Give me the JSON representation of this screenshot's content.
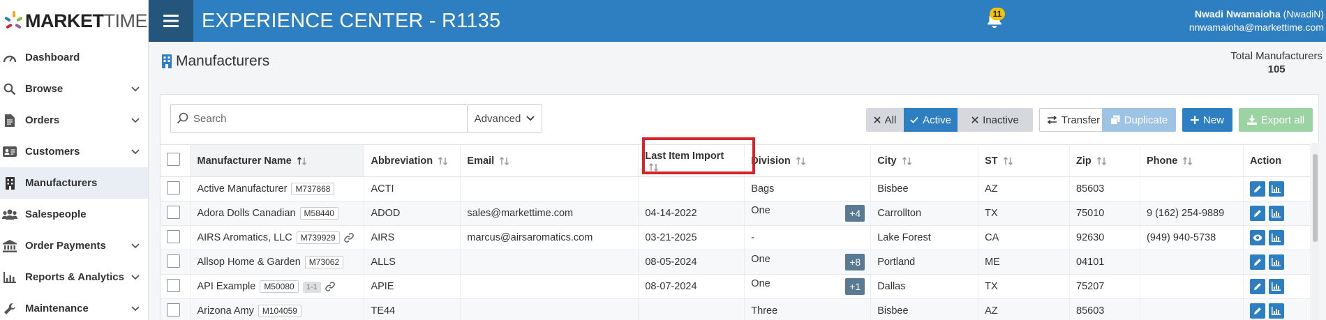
{
  "brand": {
    "logo_bold": "MARKET",
    "logo_thin": "TIME"
  },
  "header": {
    "title": "EXPERIENCE CENTER - R1135",
    "notification_count": "11",
    "user_name": "Nwadi Nwamaioha",
    "user_handle": "(NwadiN)",
    "user_email": "nnwamaioha@markettime.com"
  },
  "sidebar": {
    "items": [
      {
        "label": "Dashboard",
        "icon": "gauge-icon",
        "has_children": false
      },
      {
        "label": "Browse",
        "icon": "search-icon",
        "has_children": true
      },
      {
        "label": "Orders",
        "icon": "document-icon",
        "has_children": true
      },
      {
        "label": "Customers",
        "icon": "id-card-icon",
        "has_children": true
      },
      {
        "label": "Manufacturers",
        "icon": "building-icon",
        "has_children": false,
        "active": true
      },
      {
        "label": "Salespeople",
        "icon": "users-icon",
        "has_children": false
      },
      {
        "label": "Order Payments",
        "icon": "bank-icon",
        "has_children": true
      },
      {
        "label": "Reports & Analytics",
        "icon": "chart-icon",
        "has_children": true
      },
      {
        "label": "Maintenance",
        "icon": "wrench-icon",
        "has_children": true
      }
    ]
  },
  "page": {
    "title": "Manufacturers",
    "total_label": "Total Manufacturers",
    "total_value": "105"
  },
  "toolbar": {
    "search_placeholder": "Search",
    "advanced_label": "Advanced",
    "filter_all": "All",
    "filter_active": "Active",
    "filter_inactive": "Inactive",
    "transfer_label": "Transfer",
    "duplicate_label": "Duplicate",
    "new_label": "New",
    "export_label": "Export all"
  },
  "table": {
    "columns": {
      "name": "Manufacturer Name",
      "abbreviation": "Abbreviation",
      "email": "Email",
      "last_import": "Last Item Import",
      "division": "Division",
      "city": "City",
      "st": "ST",
      "zip": "Zip",
      "phone": "Phone",
      "action": "Action"
    },
    "rows": [
      {
        "name": "Active Manufacturer",
        "code": "M737868",
        "abbr": "ACTI",
        "email": "",
        "last_import": "",
        "division": "Bags",
        "division_extra": "",
        "city": "Bisbee",
        "st": "AZ",
        "zip": "85603",
        "phone": ""
      },
      {
        "name": "Adora Dolls Canadian",
        "code": "M58440",
        "abbr": "ADOD",
        "email": "sales@markettime.com",
        "last_import": "04-14-2022",
        "division": "One",
        "division_extra": "+4",
        "city": "Carrollton",
        "st": "TX",
        "zip": "75010",
        "phone": "9 (162) 254-9889"
      },
      {
        "name": "AIRS Aromatics, LLC",
        "code": "M739929",
        "abbr": "AIRS",
        "email": "marcus@airsaromatics.com",
        "last_import": "03-21-2025",
        "division": "-",
        "division_extra": "",
        "city": "Lake Forest",
        "st": "CA",
        "zip": "92630",
        "phone": "(949) 940-5738"
      },
      {
        "name": "Allsop Home & Garden",
        "code": "M73062",
        "abbr": "ALLS",
        "email": "",
        "last_import": "08-05-2024",
        "division": "One",
        "division_extra": "+8",
        "city": "Portland",
        "st": "ME",
        "zip": "04101",
        "phone": ""
      },
      {
        "name": "API Example",
        "code": "M50080",
        "extra_badge": "1-1",
        "abbr": "APIE",
        "email": "",
        "last_import": "08-07-2024",
        "division": "One",
        "division_extra": "+1",
        "city": "Dallas",
        "st": "TX",
        "zip": "75207",
        "phone": ""
      },
      {
        "name": "Arizona Amy",
        "code": "M104059",
        "abbr": "TE44",
        "email": "",
        "last_import": "",
        "division": "Three",
        "division_extra": "",
        "city": "Bisbee",
        "st": "AZ",
        "zip": "85603",
        "phone": ""
      }
    ]
  },
  "colors": {
    "primary": "#2d7fc1",
    "menu_dark": "#24557a",
    "highlight": "#d9232a",
    "badge_yellow": "#f5c400"
  }
}
